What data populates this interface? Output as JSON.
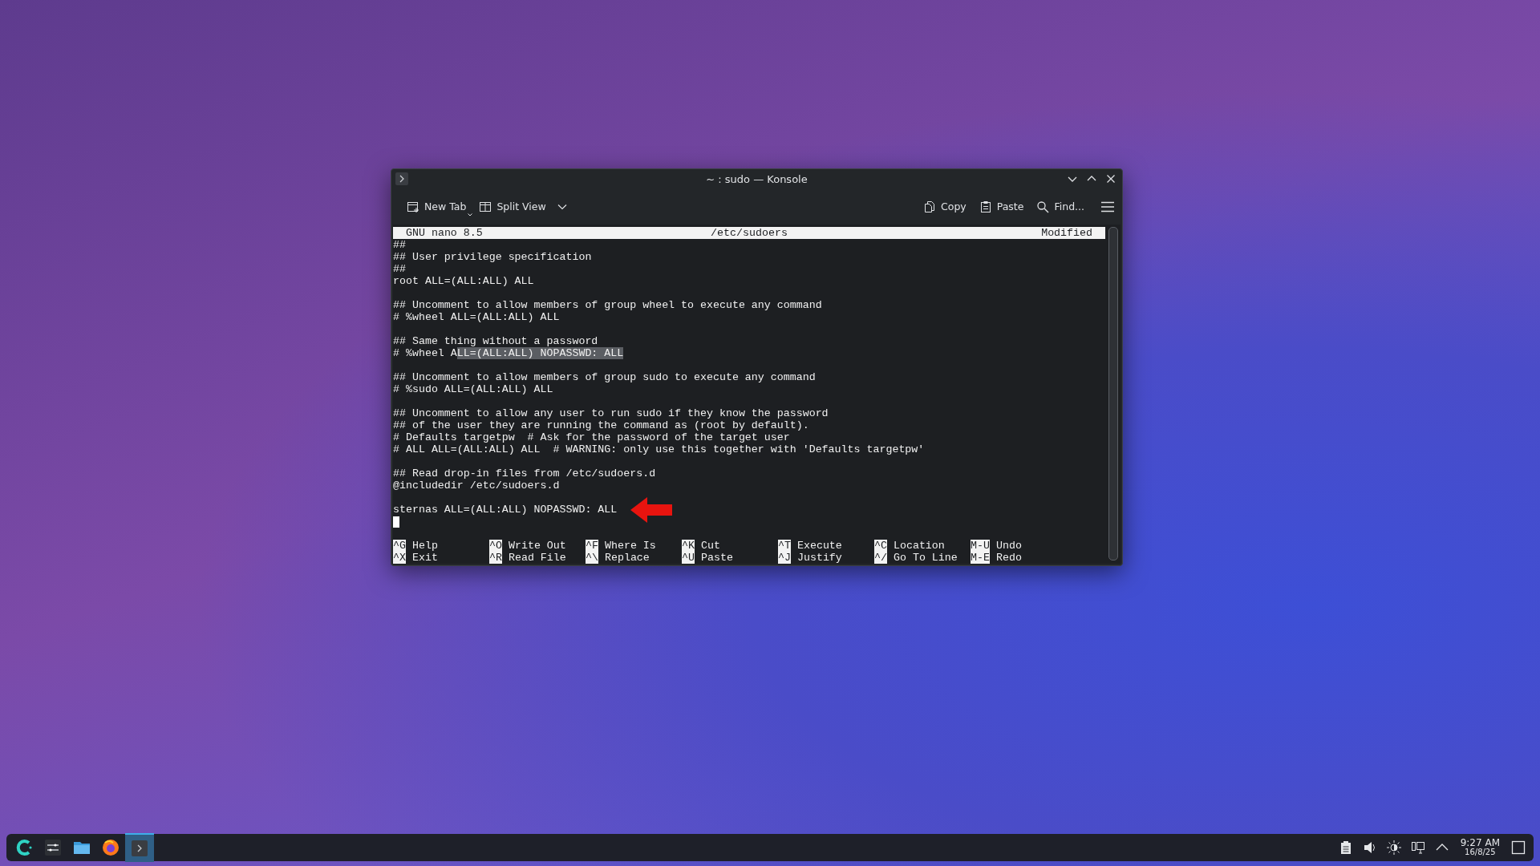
{
  "window": {
    "title": "~ : sudo — Konsole"
  },
  "toolbar": {
    "left": [
      {
        "label": "New Tab",
        "kind": "newtab"
      },
      {
        "label": "Split View",
        "kind": "split"
      }
    ],
    "right": [
      {
        "label": "Copy",
        "kind": "copy"
      },
      {
        "label": "Paste",
        "kind": "paste"
      },
      {
        "label": "Find...",
        "kind": "find"
      }
    ]
  },
  "nano": {
    "version": "GNU nano 8.5",
    "file": "/etc/sudoers",
    "status": "Modified",
    "lines": [
      {
        "text": "##"
      },
      {
        "text": "## User privilege specification"
      },
      {
        "text": "##"
      },
      {
        "text": "root ALL=(ALL:ALL) ALL"
      },
      {
        "kind": "blank"
      },
      {
        "text": "## Uncomment to allow members of group wheel to execute any command"
      },
      {
        "text": "# %wheel ALL=(ALL:ALL) ALL"
      },
      {
        "kind": "blank"
      },
      {
        "text": "## Same thing without a password"
      },
      {
        "text": "# %wheel A",
        "selected_text": "LL=(ALL:ALL) NOPASSWD: ALL"
      },
      {
        "kind": "blank"
      },
      {
        "text": "## Uncomment to allow members of group sudo to execute any command"
      },
      {
        "text": "# %sudo ALL=(ALL:ALL) ALL"
      },
      {
        "kind": "blank"
      },
      {
        "text": "## Uncomment to allow any user to run sudo if they know the password"
      },
      {
        "text": "## of the user they are running the command as (root by default)."
      },
      {
        "text": "# Defaults targetpw  # Ask for the password of the target user"
      },
      {
        "text": "# ALL ALL=(ALL:ALL) ALL  # WARNING: only use this together with 'Defaults targetpw'"
      },
      {
        "kind": "blank"
      },
      {
        "text": "## Read drop-in files from /etc/sudoers.d"
      },
      {
        "text": "@includedir /etc/sudoers.d"
      },
      {
        "kind": "blank"
      },
      {
        "text": "sternas ALL=(ALL:ALL) NOPASSWD: ALL",
        "arrow": true
      },
      {
        "kind": "cursor"
      },
      {
        "kind": "blank"
      }
    ],
    "shortcuts": [
      [
        {
          "key": "^G",
          "label": "Help"
        },
        {
          "key": "^O",
          "label": "Write Out"
        },
        {
          "key": "^F",
          "label": "Where Is"
        },
        {
          "key": "^K",
          "label": "Cut"
        },
        {
          "key": "^T",
          "label": "Execute"
        },
        {
          "key": "^C",
          "label": "Location"
        },
        {
          "key": "M-U",
          "label": "Undo"
        }
      ],
      [
        {
          "key": "^X",
          "label": "Exit"
        },
        {
          "key": "^R",
          "label": "Read File"
        },
        {
          "key": "^\\",
          "label": "Replace"
        },
        {
          "key": "^U",
          "label": "Paste"
        },
        {
          "key": "^J",
          "label": "Justify"
        },
        {
          "key": "^/",
          "label": "Go To Line"
        },
        {
          "key": "M-E",
          "label": "Redo"
        }
      ]
    ]
  },
  "taskbar": {
    "apps": [
      {
        "kind": "launcher",
        "active": false
      },
      {
        "kind": "settings",
        "active": false
      },
      {
        "kind": "files",
        "active": false
      },
      {
        "kind": "browser",
        "active": false
      },
      {
        "kind": "terminal",
        "active": true
      }
    ],
    "tray": [
      {
        "kind": "clipboard"
      },
      {
        "kind": "volume"
      },
      {
        "kind": "brightness"
      },
      {
        "kind": "network"
      },
      {
        "kind": "expand"
      }
    ],
    "time": "9:27 AM",
    "date": "16/8/25"
  }
}
